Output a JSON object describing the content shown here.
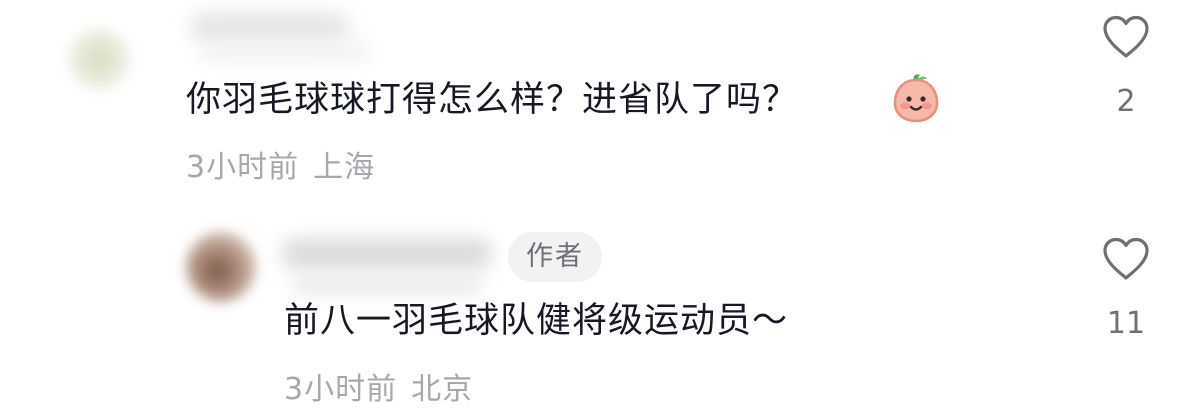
{
  "comments": [
    {
      "text": "你羽毛球球打得怎么样？进省队了吗？",
      "time": "3小时前",
      "location": "上海",
      "likes": "2",
      "emoji": "smiling-peach-emoji"
    },
    {
      "badge": "作者",
      "text": "前八一羽毛球队健将级运动员～",
      "time": "3小时前",
      "location": "北京",
      "likes": "11"
    }
  ],
  "icons": {
    "like": "heart-outline-icon"
  },
  "colors": {
    "text": "#161823",
    "meta": "#a7a8ad",
    "badge_bg": "#f2f2f3",
    "badge_text": "#6f7076",
    "icon": "#6f7076"
  }
}
